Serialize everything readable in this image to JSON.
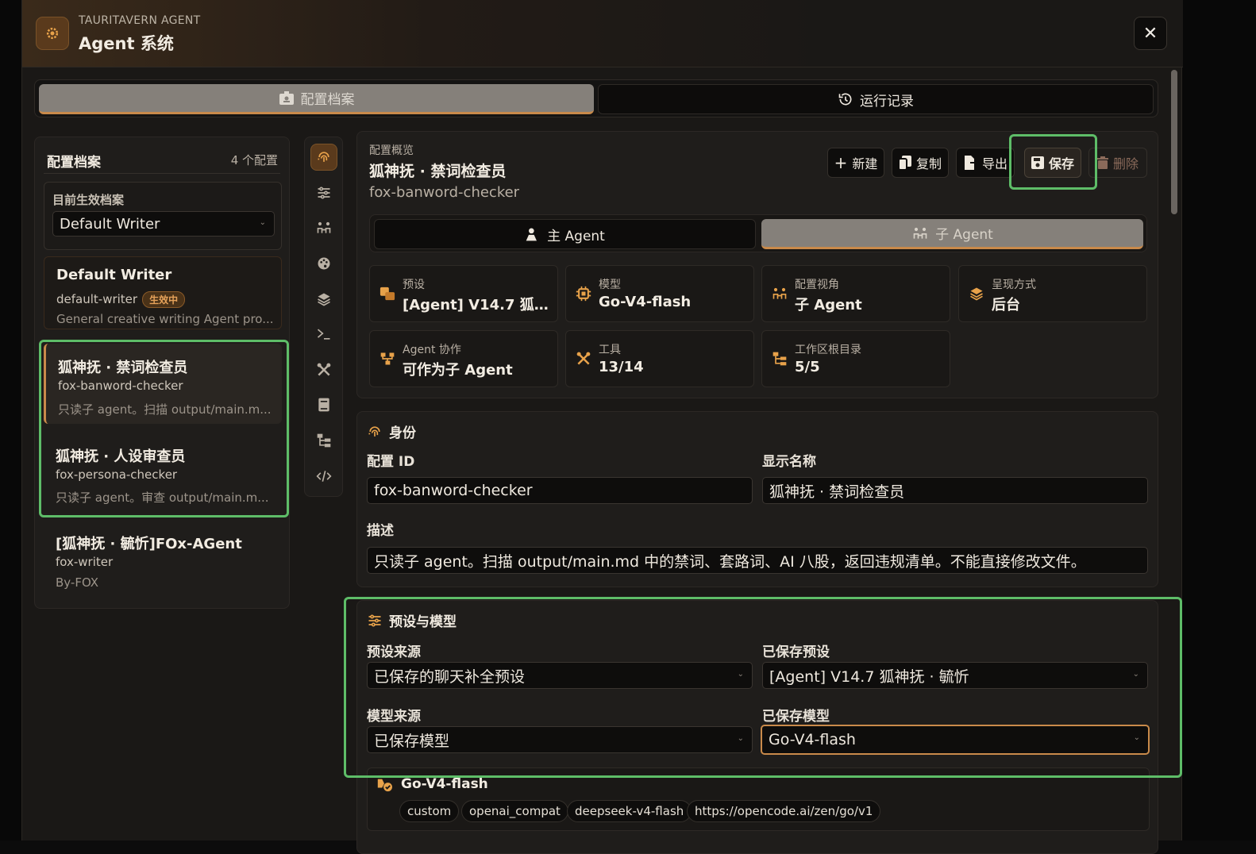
{
  "header": {
    "subtitle": "TAURITAVERN AGENT",
    "title": "Agent 系统",
    "close_label": "✕"
  },
  "main_tabs": [
    {
      "label": "配置档案",
      "active": true
    },
    {
      "label": "运行记录",
      "active": false
    }
  ],
  "sidebar": {
    "title": "配置档案",
    "count": "4 个配置",
    "active_label": "目前生效档案",
    "active_value": "Default Writer",
    "profiles": [
      {
        "name": "Default Writer",
        "id": "default-writer",
        "badge": "生效中",
        "desc": "General creative writing Agent pro..."
      },
      {
        "name": "狐神抚 · 禁词检查员",
        "id": "fox-banword-checker",
        "desc": "只读子 agent。扫描 output/main.m..."
      },
      {
        "name": "狐神抚 · 人设审查员",
        "id": "fox-persona-checker",
        "desc": "只读子 agent。审查 output/main.m..."
      },
      {
        "name": "[狐神抚 · 毓忻]FOx-AGent",
        "id": "fox-writer",
        "desc": "By-FOX"
      }
    ]
  },
  "rail_icons": [
    "fingerprint-icon",
    "sliders-icon",
    "agents-icon",
    "palette-icon",
    "layers-icon",
    "terminal-icon",
    "tools-icon",
    "book-icon",
    "tree-icon",
    "code-icon"
  ],
  "overview": {
    "label": "配置概览",
    "title": "狐神抚 · 禁词检查员",
    "id": "fox-banword-checker",
    "actions": {
      "new": "新建",
      "copy": "复制",
      "export": "导出",
      "save": "保存",
      "delete": "删除"
    },
    "subtabs": [
      {
        "label": "主 Agent",
        "active": false
      },
      {
        "label": "子 Agent",
        "active": true
      }
    ],
    "stats": [
      {
        "key": "预设",
        "value": "[Agent] V14.7 狐神..."
      },
      {
        "key": "模型",
        "value": "Go-V4-flash"
      },
      {
        "key": "配置视角",
        "value": "子 Agent"
      },
      {
        "key": "呈现方式",
        "value": "后台"
      },
      {
        "key": "Agent 协作",
        "value": "可作为子 Agent"
      },
      {
        "key": "工具",
        "value": "13/14"
      },
      {
        "key": "工作区根目录",
        "value": "5/5"
      }
    ]
  },
  "identity": {
    "heading": "身份",
    "id_label": "配置 ID",
    "id_value": "fox-banword-checker",
    "name_label": "显示名称",
    "name_value": "狐神抚 · 禁词检查员",
    "desc_label": "描述",
    "desc_value": "只读子 agent。扫描 output/main.md 中的禁词、套路词、AI 八股，返回违规清单。不能直接修改文件。"
  },
  "preset_model": {
    "heading": "预设与模型",
    "preset_source_label": "预设来源",
    "preset_source_value": "已保存的聊天补全预设",
    "saved_preset_label": "已保存预设",
    "saved_preset_value": "[Agent] V14.7 狐神抚 · 毓忻",
    "model_source_label": "模型来源",
    "model_source_value": "已保存模型",
    "saved_model_label": "已保存模型",
    "saved_model_value": "Go-V4-flash",
    "model_card": {
      "name": "Go-V4-flash",
      "chips": [
        "custom",
        "openai_compat",
        "deepseek-v4-flash",
        "https://opencode.ai/zen/go/v1"
      ]
    }
  },
  "colors": {
    "accent": "#c98a4a",
    "highlight": "#5ebd68",
    "icon": "#e8a24a"
  }
}
